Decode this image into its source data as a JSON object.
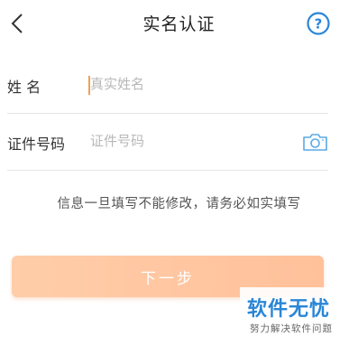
{
  "header": {
    "title": "实名认证",
    "back_icon": "chevron-left-icon",
    "help_icon": "question-circle-icon",
    "help_symbol": "?"
  },
  "form": {
    "name_label": "姓 名",
    "name_placeholder": "真实姓名",
    "id_label": "证件号码",
    "id_placeholder": "证件号码",
    "camera_icon": "camera-icon"
  },
  "notice": "信息一旦填写不能修改，请务必如实填写",
  "next_button": "下一步",
  "watermark": {
    "title": "软件无忧",
    "subtitle": "努力解决软件问题"
  },
  "colors": {
    "accent_blue": "#2a86d6",
    "button_gradient_start": "#ffcda9",
    "button_gradient_end": "#ffc19a",
    "caret": "#f0a050",
    "camera_blue": "#5aa9e6"
  }
}
